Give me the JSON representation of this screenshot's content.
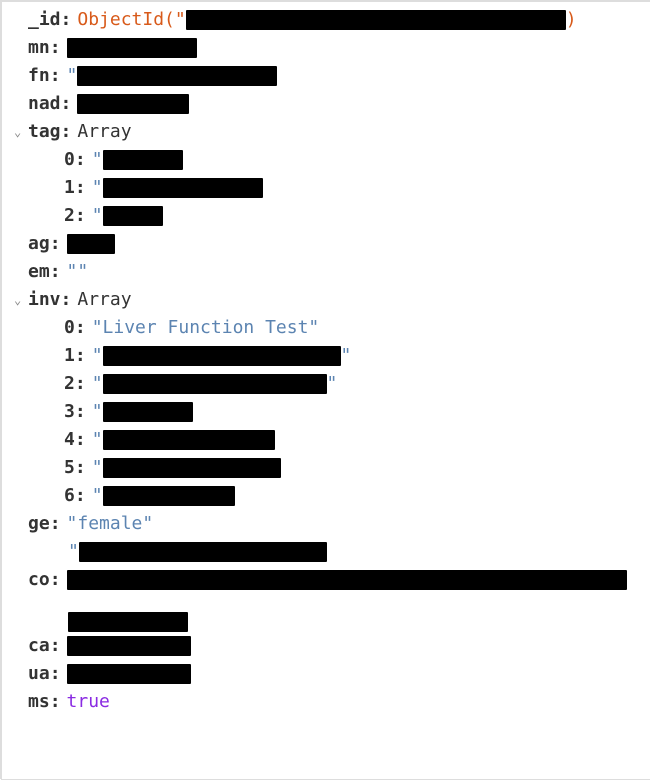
{
  "colors": {
    "string": "#5c84b1",
    "objectId": "#d85a1a",
    "bool": "#8a2be2"
  },
  "fields": {
    "id_key": "_id",
    "id_prefix": "ObjectId(\"",
    "id_suffix": ")",
    "mn_key": "mn",
    "fn_key": "fn",
    "nad_key": "nad",
    "tag_key": "tag",
    "tag_type": "Array",
    "tag_0_key": "0",
    "tag_1_key": "1",
    "tag_2_key": "2",
    "ag_key": "ag",
    "em_key": "em",
    "em_val": "\"\"",
    "inv_key": "inv",
    "inv_type": "Array",
    "inv_0_key": "0",
    "inv_0_val": "\"Liver Function Test\"",
    "inv_1_key": "1",
    "inv_2_key": "2",
    "inv_3_key": "3",
    "inv_4_key": "4",
    "inv_5_key": "5",
    "inv_6_key": "6",
    "ge_key": "ge",
    "ge_val": "\"female\"",
    "co_key": "co",
    "ca_key": "ca",
    "ua_key": "ua",
    "ms_key": "ms",
    "ms_val": "true"
  },
  "quotes": {
    "open": "\"",
    "close": "\""
  }
}
